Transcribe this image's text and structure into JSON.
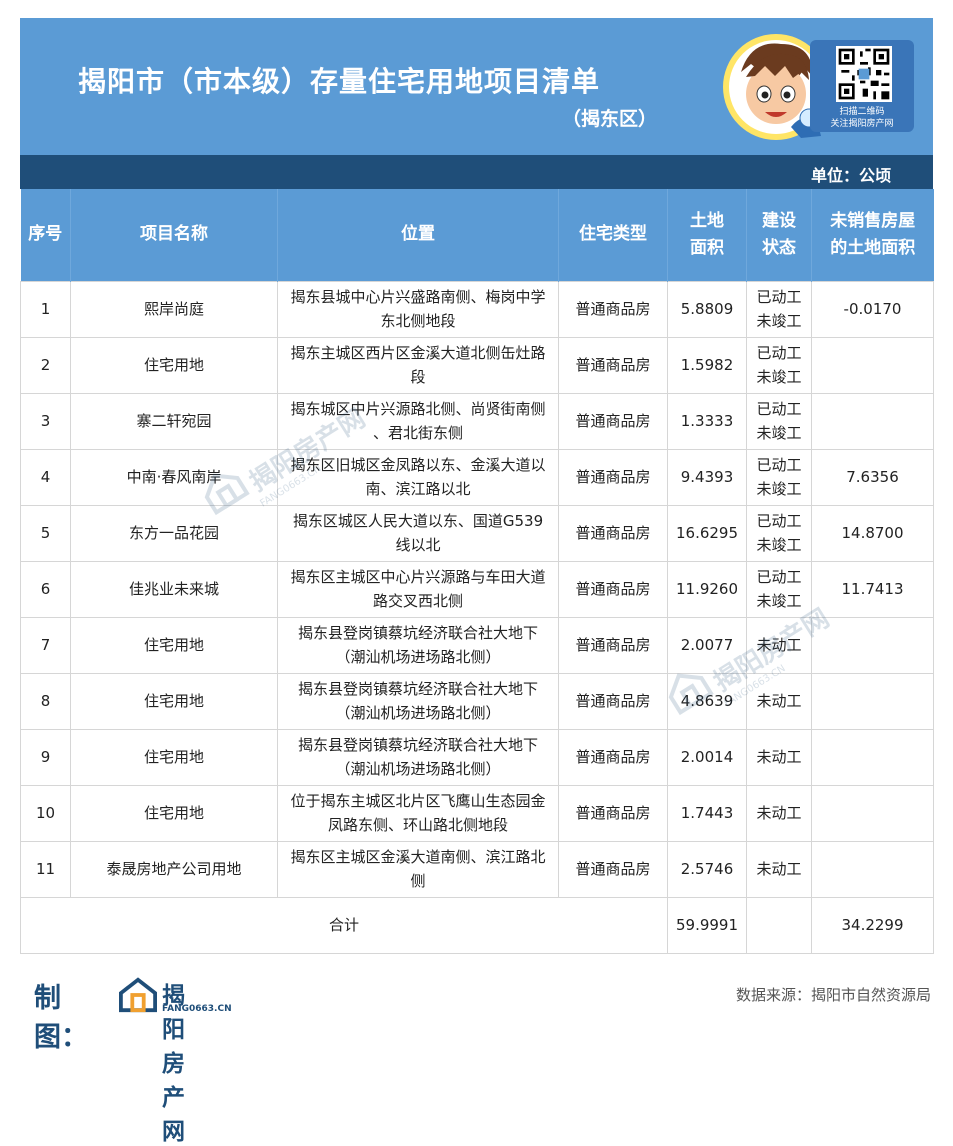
{
  "header": {
    "title": "揭阳市（市本级）存量住宅用地项目清单",
    "subtitle": "（揭东区）",
    "qr_caption_1": "扫描二维码",
    "qr_caption_2": "关注揭阳房产网"
  },
  "unit": "单位：公顷",
  "table": {
    "headers": {
      "no": "序号",
      "name": "项目名称",
      "location": "位置",
      "type": "住宅类型",
      "area_1": "土地",
      "area_2": "面积",
      "status_1": "建设",
      "status_2": "状态",
      "unsold_1": "未销售房屋",
      "unsold_2": "的土地面积"
    },
    "rows": [
      {
        "no": "1",
        "name": "熙岸尚庭",
        "loc1": "揭东县城中心片兴盛路南侧、梅岗中学",
        "loc2": "东北侧地段",
        "type": "普通商品房",
        "area": "5.8809",
        "st1": "已动工",
        "st2": "未竣工",
        "unsold": "-0.0170"
      },
      {
        "no": "2",
        "name": "住宅用地",
        "loc1": "揭东主城区西片区金溪大道北侧缶灶路",
        "loc2": "段",
        "type": "普通商品房",
        "area": "1.5982",
        "st1": "已动工",
        "st2": "未竣工",
        "unsold": ""
      },
      {
        "no": "3",
        "name": "寨二轩宛园",
        "loc1": "揭东城区中片兴源路北侧、尚贤街南侧",
        "loc2": "、君北街东侧",
        "type": "普通商品房",
        "area": "1.3333",
        "st1": "已动工",
        "st2": "未竣工",
        "unsold": ""
      },
      {
        "no": "4",
        "name": "中南·春风南岸",
        "loc1": "揭东区旧城区金凤路以东、金溪大道以",
        "loc2": "南、滨江路以北",
        "type": "普通商品房",
        "area": "9.4393",
        "st1": "已动工",
        "st2": "未竣工",
        "unsold": "7.6356"
      },
      {
        "no": "5",
        "name": "东方一品花园",
        "loc1": "揭东区城区人民大道以东、国道G539",
        "loc2": "线以北",
        "type": "普通商品房",
        "area": "16.6295",
        "st1": "已动工",
        "st2": "未竣工",
        "unsold": "14.8700"
      },
      {
        "no": "6",
        "name": "佳兆业未来城",
        "loc1": "揭东区主城区中心片兴源路与车田大道",
        "loc2": "路交叉西北侧",
        "type": "普通商品房",
        "area": "11.9260",
        "st1": "已动工",
        "st2": "未竣工",
        "unsold": "11.7413"
      },
      {
        "no": "7",
        "name": "住宅用地",
        "loc1": "揭东县登岗镇蔡坑经济联合社大地下",
        "loc2": "（潮汕机场进场路北侧）",
        "type": "普通商品房",
        "area": "2.0077",
        "st1": "未动工",
        "st2": "",
        "unsold": ""
      },
      {
        "no": "8",
        "name": "住宅用地",
        "loc1": "揭东县登岗镇蔡坑经济联合社大地下",
        "loc2": "（潮汕机场进场路北侧）",
        "type": "普通商品房",
        "area": "4.8639",
        "st1": "未动工",
        "st2": "",
        "unsold": ""
      },
      {
        "no": "9",
        "name": "住宅用地",
        "loc1": "揭东县登岗镇蔡坑经济联合社大地下",
        "loc2": "（潮汕机场进场路北侧）",
        "type": "普通商品房",
        "area": "2.0014",
        "st1": "未动工",
        "st2": "",
        "unsold": ""
      },
      {
        "no": "10",
        "name": "住宅用地",
        "loc1": "位于揭东主城区北片区飞鹰山生态园金",
        "loc2": "凤路东侧、环山路北侧地段",
        "type": "普通商品房",
        "area": "1.7443",
        "st1": "未动工",
        "st2": "",
        "unsold": ""
      },
      {
        "no": "11",
        "name": "泰晟房地产公司用地",
        "loc1": "揭东区主城区金溪大道南侧、滨江路北",
        "loc2": "侧",
        "type": "普通商品房",
        "area": "2.5746",
        "st1": "未动工",
        "st2": "",
        "unsold": ""
      }
    ],
    "total": {
      "label": "合计",
      "area": "59.9991",
      "unsold": "34.2299"
    }
  },
  "footer": {
    "made_by": "制图：",
    "logo_name": "揭阳房产网",
    "logo_domain": "FANG0663.CN",
    "source": "数据来源：揭阳市自然资源局"
  },
  "watermark": {
    "name": "揭阳房产网",
    "domain": "FANG0663.CN"
  },
  "colors": {
    "header_blue": "#5b9bd5",
    "dark_blue": "#1f4e79"
  }
}
